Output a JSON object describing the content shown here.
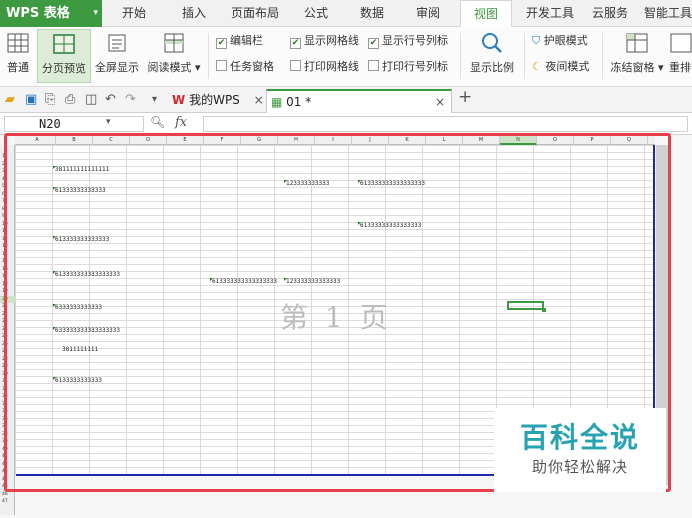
{
  "app": {
    "name": "WPS 表格"
  },
  "menu": {
    "tabs": [
      "开始",
      "插入",
      "页面布局",
      "公式",
      "数据",
      "审阅",
      "视图",
      "开发工具",
      "云服务",
      "智能工具"
    ],
    "active": "视图"
  },
  "ribbon": {
    "views": {
      "normal": "普通",
      "page_break": "分页预览",
      "full_screen": "全屏显示",
      "reading": "阅读模式"
    },
    "checkboxes": {
      "edit_bar": "编辑栏",
      "task_pane": "任务窗格",
      "show_gridlines": "显示网格线",
      "print_gridlines": "打印网格线",
      "show_headings": "显示行号列标",
      "print_headings": "打印行号列标"
    },
    "zoom": "显示比例",
    "eye_mode": "护眼模式",
    "night_mode": "夜间模式",
    "freeze": "冻结窗格",
    "rearrange": "重排"
  },
  "tabs": {
    "home": "我的WPS",
    "doc": "01 *"
  },
  "formula": {
    "cell_ref": "N20",
    "fx": "fx"
  },
  "sheet": {
    "columns": [
      "A",
      "B",
      "C",
      "D",
      "E",
      "F",
      "G",
      "H",
      "I",
      "J",
      "K",
      "L",
      "M",
      "N",
      "O",
      "P",
      "Q"
    ],
    "selected_col": "N",
    "rows": [
      "1",
      "2",
      "3",
      "4",
      "5",
      "6",
      "7",
      "8",
      "9",
      "10",
      "11",
      "12",
      "13",
      "14",
      "15",
      "16",
      "17",
      "18",
      "19",
      "20",
      "21",
      "22",
      "23",
      "24",
      "25",
      "26",
      "27",
      "28",
      "29",
      "30",
      "31",
      "32",
      "33",
      "34",
      "35",
      "36",
      "37",
      "38",
      "39",
      "40",
      "41",
      "42",
      "43",
      "44",
      "45",
      "46",
      "47"
    ],
    "selected_row": "20",
    "cells": {
      "b3": "381111111111111",
      "b6": "61333333333333",
      "h5": "123333333333",
      "j5": "613333333333333333",
      "j10": "61333333333333333",
      "b12": "613333333333333",
      "b16": "613333333333333333",
      "f17": "613333333333333333",
      "h17": "123333333333333",
      "b20": "6333333333333",
      "b23": "633333333333333333",
      "b25": "3811111111",
      "b29": "6133333333333"
    },
    "page_label": "第 1 页"
  },
  "watermark": {
    "title": "百科全说",
    "subtitle": "助你轻松解决"
  }
}
